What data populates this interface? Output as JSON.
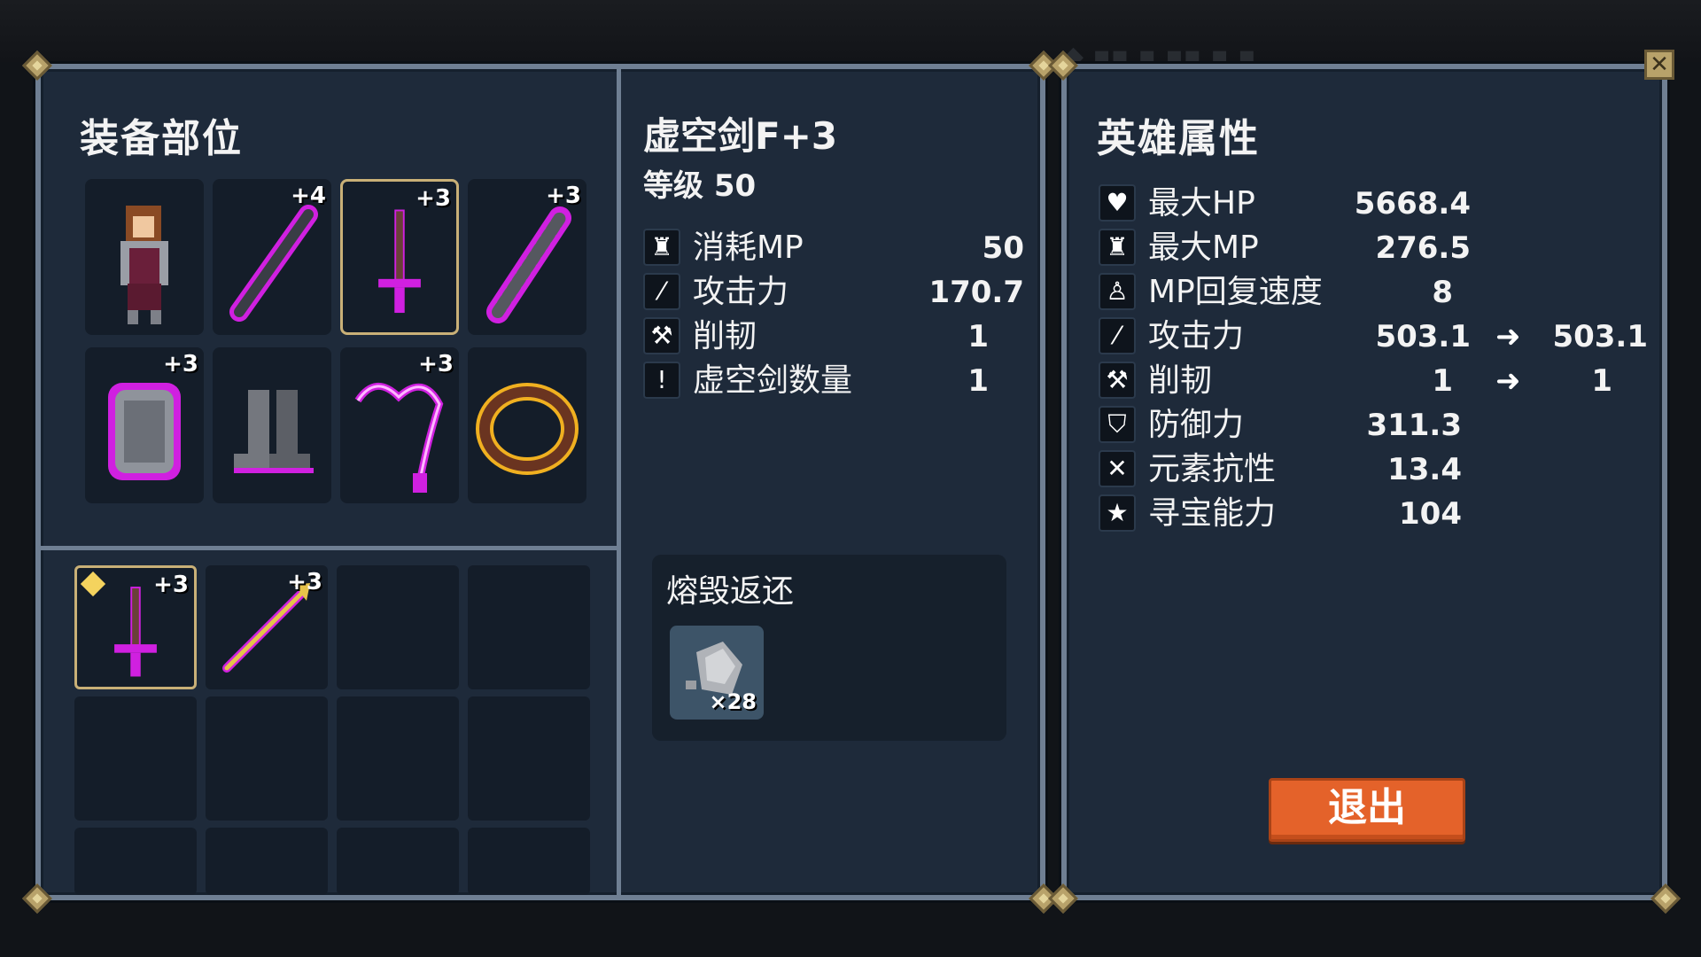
{
  "equipment": {
    "title": "装备部位",
    "slots": [
      {
        "name": "hero",
        "plus": ""
      },
      {
        "name": "dark-sword",
        "plus": "+4"
      },
      {
        "name": "void-sword",
        "plus": "+3"
      },
      {
        "name": "chain-sword",
        "plus": "+3"
      },
      {
        "name": "armor",
        "plus": "+3"
      },
      {
        "name": "boots",
        "plus": ""
      },
      {
        "name": "necklace",
        "plus": "+3"
      },
      {
        "name": "ring",
        "plus": ""
      }
    ]
  },
  "inventory": {
    "items": [
      {
        "name": "void-sword",
        "plus": "+3"
      },
      {
        "name": "golden-spear",
        "plus": "+3"
      }
    ]
  },
  "weapon": {
    "name": "虚空剑F+3",
    "level_label": "等级 50",
    "stats": [
      {
        "icon": "potion-icon",
        "label": "消耗MP",
        "value": "50"
      },
      {
        "icon": "sword-icon",
        "label": "攻击力",
        "value": "170.7"
      },
      {
        "icon": "axe-icon",
        "label": "削韧",
        "value": "1"
      },
      {
        "icon": "exclamation-icon",
        "label": "虚空剑数量",
        "value": "1"
      }
    ],
    "smelt": {
      "title": "熔毁返还",
      "item_count": "×28"
    }
  },
  "hero": {
    "title": "英雄属性",
    "stats": [
      {
        "icon": "heart-icon",
        "label": "最大HP",
        "value": "5668.4",
        "new": ""
      },
      {
        "icon": "potion-icon",
        "label": "最大MP",
        "value": "276.5",
        "new": ""
      },
      {
        "icon": "mp-regen-icon",
        "label": "MP回复速度",
        "value": "8",
        "new": ""
      },
      {
        "icon": "sword-icon",
        "label": "攻击力",
        "value": "503.1",
        "new": "503.1"
      },
      {
        "icon": "axe-icon",
        "label": "削韧",
        "value": "1",
        "new": "1"
      },
      {
        "icon": "shield-icon",
        "label": "防御力",
        "value": "311.3",
        "new": ""
      },
      {
        "icon": "element-icon",
        "label": "元素抗性",
        "value": "13.4",
        "new": ""
      },
      {
        "icon": "star-icon",
        "label": "寻宝能力",
        "value": "104",
        "new": ""
      }
    ],
    "arrow": "➜",
    "exit_label": "退出",
    "close_glyph": "✕"
  }
}
